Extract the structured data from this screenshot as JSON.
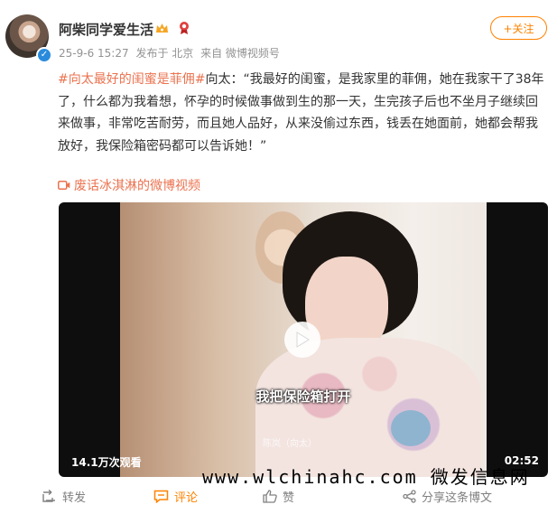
{
  "post": {
    "username": "阿柴同学爱生活",
    "timestamp": "25-9-6 15:27",
    "location": "发布于 北京",
    "source": "来自 微博视频号",
    "follow_label": "+关注",
    "hashtag": "#向太最好的闺蜜是菲佣#",
    "body": "向太：“我最好的闺蜜，是我家里的菲佣，她在我家干了38年了，什么都为我着想，怀孕的时候做事做到生的那一天，生完孩子后也不坐月子继续回来做事，非常吃苦耐劳，而且她人品好，从来没偷过东西，钱丢在她面前，她都会帮我放好，我保险箱密码都可以告诉她！”",
    "video_link": "废话冰淇淋的微博视频"
  },
  "video": {
    "subtitle": "我把保险箱打开",
    "speaker_tag": "陈岚（向太）",
    "views": "14.1万次观看",
    "duration": "02:52"
  },
  "watermark": "www.wlchinahc.com 微发信息网",
  "actions": {
    "forward": "转发",
    "comment": "评论",
    "like": "赞",
    "share": "分享这条博文"
  },
  "colors": {
    "accent": "#ff8200",
    "link": "#eb7350",
    "verify": "#2a8bdc"
  }
}
